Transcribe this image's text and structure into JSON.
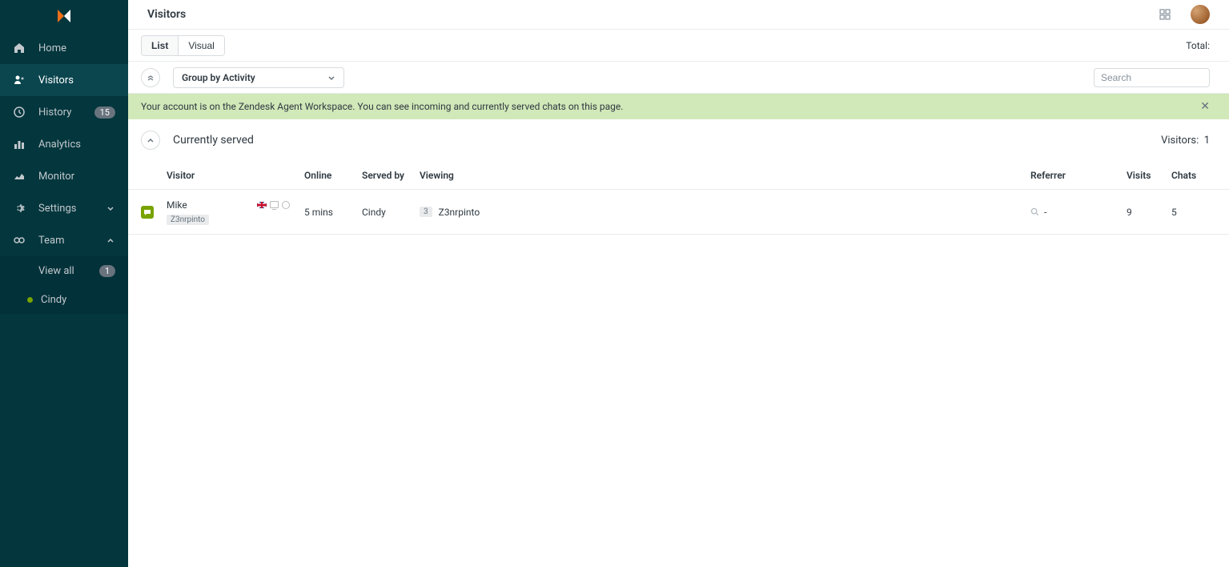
{
  "header": {
    "title": "Visitors",
    "total_label": "Total:"
  },
  "sidebar": {
    "items": [
      {
        "label": "Home"
      },
      {
        "label": "Visitors"
      },
      {
        "label": "History",
        "badge": "15"
      },
      {
        "label": "Analytics"
      },
      {
        "label": "Monitor"
      },
      {
        "label": "Settings"
      },
      {
        "label": "Team"
      }
    ],
    "team_sub": {
      "view_all": {
        "label": "View all",
        "badge": "1"
      },
      "agent": {
        "name": "Cindy"
      }
    }
  },
  "toolbar": {
    "list_label": "List",
    "visual_label": "Visual",
    "group_label": "Group by Activity",
    "search_placeholder": "Search"
  },
  "banner": {
    "message": "Your account is on the Zendesk Agent Workspace. You can see incoming and currently served chats on this page."
  },
  "section": {
    "title": "Currently served",
    "visitors_label": "Visitors:",
    "visitors_count": "1"
  },
  "table": {
    "headers": {
      "visitor": "Visitor",
      "online": "Online",
      "served_by": "Served by",
      "viewing": "Viewing",
      "referrer": "Referrer",
      "visits": "Visits",
      "chats": "Chats"
    },
    "rows": [
      {
        "name": "Mike",
        "tag": "Z3nrpinto",
        "online": "5 mins",
        "served_by": "Cindy",
        "page_count": "3",
        "viewing": "Z3nrpinto",
        "referrer": "-",
        "visits": "9",
        "chats": "5"
      }
    ]
  }
}
